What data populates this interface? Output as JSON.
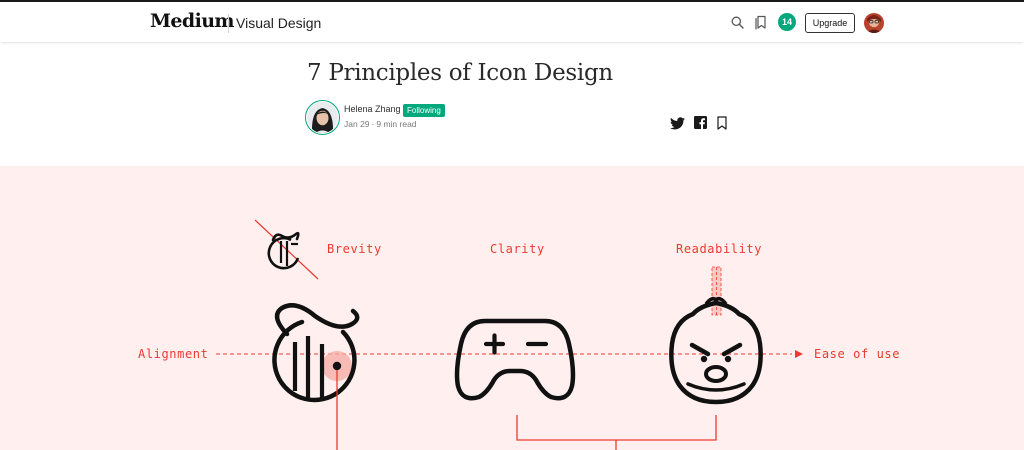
{
  "header": {
    "brand": "Medium",
    "publication": "Visual Design",
    "notifications_count": "14",
    "upgrade_label": "Upgrade",
    "icons": [
      "search-icon",
      "bookmarks-icon",
      "user-avatar"
    ]
  },
  "article": {
    "title": "7 Principles of Icon Design",
    "author": "Helena Zhang",
    "follow_status": "Following",
    "date": "Jan 29",
    "read_time": "9 min read",
    "share_icons": [
      "twitter-icon",
      "facebook-icon",
      "bookmark-icon"
    ]
  },
  "hero": {
    "labels": {
      "brevity": "Brevity",
      "clarity": "Clarity",
      "readability": "Readability",
      "alignment": "Alignment",
      "ease_of_use": "Ease of use"
    },
    "background": "#fff0ef",
    "accent": "#eb3a2e",
    "icons": [
      "nyt-logo-small",
      "nyt-logo-large",
      "game-controller-icon",
      "angry-face-icon"
    ]
  },
  "colors": {
    "green": "#03a87c",
    "text": "#1a1a1a"
  }
}
